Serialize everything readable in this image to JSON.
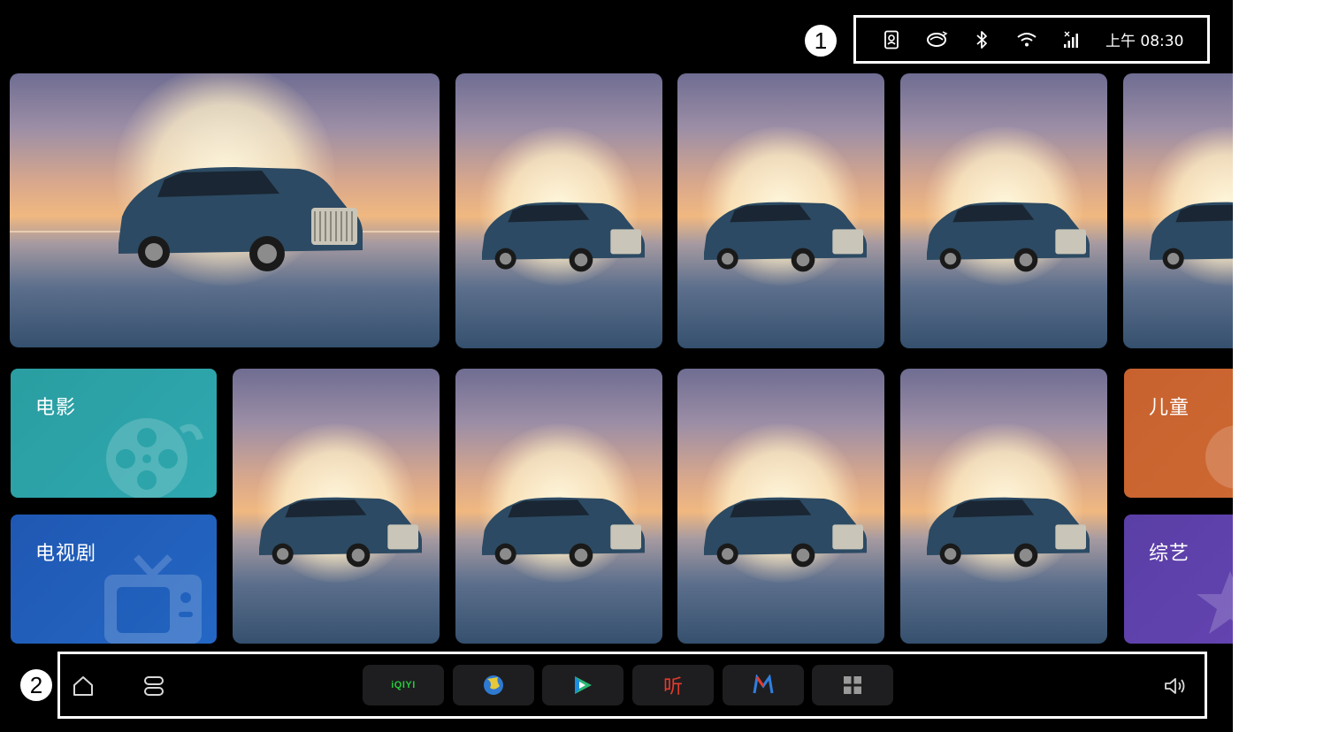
{
  "status_bar": {
    "time": "上午 08:30",
    "icons": [
      "contact-card-icon",
      "cycle-icon",
      "bluetooth-icon",
      "wifi-icon",
      "cellular-signal-icon"
    ]
  },
  "markers": {
    "status": "1",
    "dock": "2"
  },
  "categories": {
    "movie": "电影",
    "tv": "电视剧",
    "kids": "儿童",
    "variety": "综艺"
  },
  "dock": {
    "left_icons": [
      "home-icon",
      "multitask-icon"
    ],
    "apps": [
      {
        "name": "iqiyi-app",
        "label": "iQIYI"
      },
      {
        "name": "globe-app",
        "icon": "globe-icon"
      },
      {
        "name": "video-play-app",
        "icon": "play-icon"
      },
      {
        "name": "ting-app",
        "label": "听"
      },
      {
        "name": "m-app",
        "icon": "m-logo-icon"
      },
      {
        "name": "all-apps",
        "icon": "grid-icon"
      }
    ],
    "right_icon": "volume-icon"
  },
  "colors": {
    "movie": "#2a9ea1",
    "tv": "#1f58b3",
    "kids": "#c7622f",
    "variety": "#5a3fa6",
    "iqiyi": "#28c83c",
    "ting": "#e23a2e"
  }
}
